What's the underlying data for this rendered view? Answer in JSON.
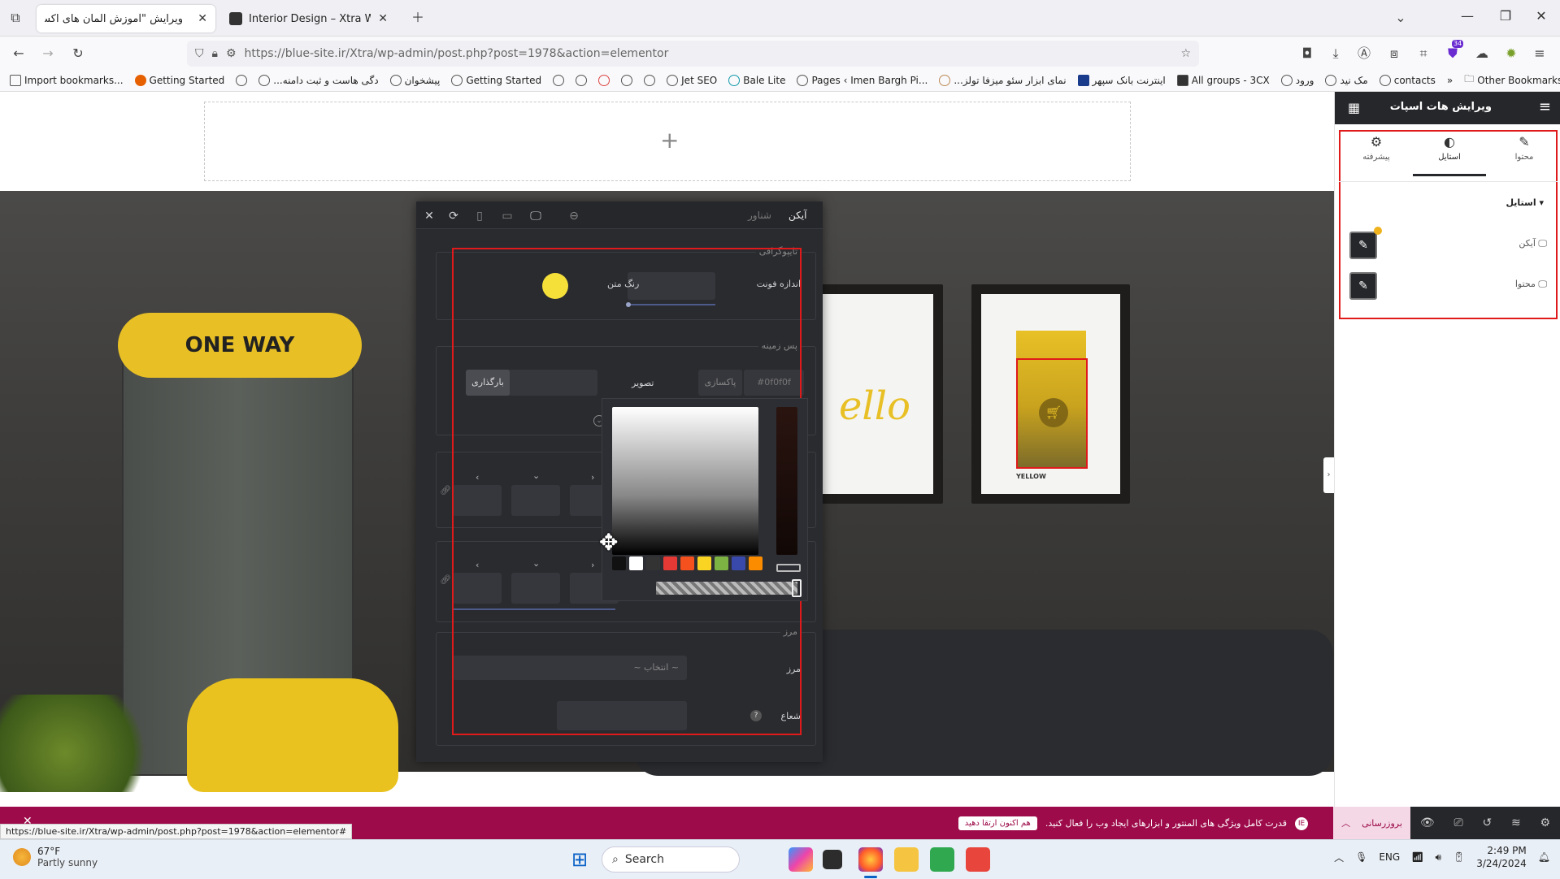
{
  "tabs": [
    {
      "title": "ویرایش \"آموزش المان های اکسترا – ...",
      "active": true
    },
    {
      "title": "Interior Design – Xtra WordPress",
      "active": false
    }
  ],
  "url": "https://blue-site.ir/Xtra/wp-admin/post.php?post=1978&action=elementor",
  "bookmarks": [
    "Import bookmarks...",
    "Getting Started",
    "...دگی هاست و ثبت دامنه",
    "پیشخوان",
    "Getting Started",
    "Jet SEO",
    "Bale Lite",
    "Pages ‹ Imen Bargh Pi...",
    "...نمای ابزار سئو میزفا تولز",
    "اینترنت بانک سپهر",
    "All groups - 3CX",
    "ورود",
    "مک نید",
    "contacts"
  ],
  "other_bookmarks": "Other Bookmarks",
  "extension_badge": "34",
  "popover": {
    "tab_icon": "آیکن",
    "tab_hover": "شناور",
    "typography_title": "تایپوگرافی",
    "font_size_label": "اندازه فونت",
    "text_color_label": "رنگ متن",
    "text_color": "#f5e03a",
    "background_title": "پس زمینه",
    "hex_value": "#0f0f0f",
    "clear_label": "پاکسازی",
    "image_label": "تصویر",
    "upload_label": "بارگذاری",
    "border_title": "مرز",
    "border_label": "مرز",
    "border_select": "~ انتخاب ~",
    "radius_label": "شعاع"
  },
  "swatches": [
    "#111111",
    "#ffffff",
    "#333333",
    "#e53935",
    "#f4511e",
    "#f9d423",
    "#7cb342",
    "#3949ab",
    "#fb8c00"
  ],
  "poster_text": "ello",
  "poster_caption": "YELLOW",
  "skateboard_text": "ONE WAY",
  "sidebar": {
    "title": "ویرایش هات اسپات",
    "tabs": [
      {
        "label": "محتوا",
        "icon": "pencil-icon"
      },
      {
        "label": "استایل",
        "icon": "contrast-icon",
        "active": true
      },
      {
        "label": "پیشرفته",
        "icon": "gear-icon"
      }
    ],
    "section_title": "استایل",
    "rows": [
      {
        "label": "آیکن"
      },
      {
        "label": "محتوا"
      }
    ]
  },
  "bottom": {
    "promo_text": "قدرت کامل ویژگی های المنتور و ابزارهای ایجاد وب را فعال کنید.",
    "promo_button": "هم اکنون ارتقا دهید",
    "update_label": "بروزرسانی"
  },
  "status_url": "https://blue-site.ir/Xtra/wp-admin/post.php?post=1978&action=elementor#",
  "taskbar": {
    "temp": "67°F",
    "weather": "Partly sunny",
    "search_placeholder": "Search",
    "lang": "ENG",
    "time": "2:49 PM",
    "date": "3/24/2024"
  }
}
